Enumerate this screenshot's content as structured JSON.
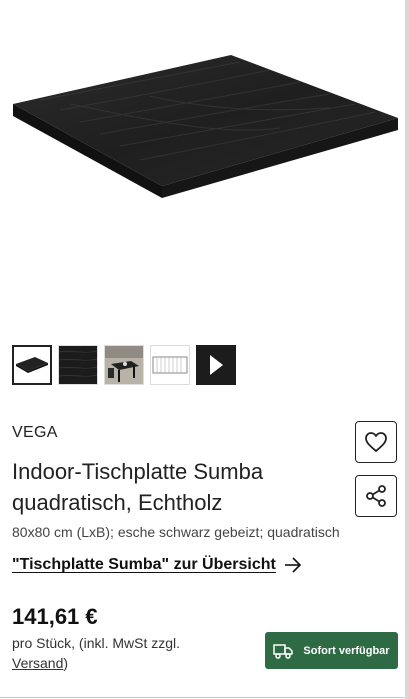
{
  "gallery": {
    "thumbnails": [
      "table-top-angled",
      "wood-texture",
      "restaurant-scene",
      "dimension-drawing"
    ],
    "next_icon": "play-triangle-icon"
  },
  "product": {
    "brand": "VEGA",
    "title": "Indoor-Tischplatte Sumba quadratisch, Echtholz",
    "subtitle": "80x80 cm (LxB); esche schwarz gebeizt; quadratisch",
    "overview_link": "\"Tischplatte Sumba\" zur Übersicht"
  },
  "price": {
    "amount": "141,61 €",
    "note_prefix": "pro Stück, (inkl. MwSt zzgl.",
    "shipping_link": "Versand",
    "note_suffix": ")"
  },
  "availability": {
    "label": "Sofort verfügbar",
    "icon": "truck-icon",
    "color": "#2e6b45"
  },
  "actions": {
    "wishlist_icon": "heart-icon",
    "share_icon": "share-icon"
  }
}
